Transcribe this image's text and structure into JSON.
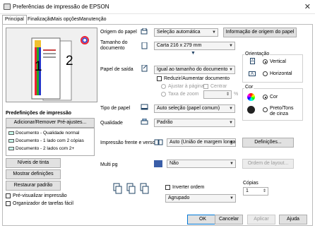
{
  "window": {
    "title": "Preferências de impressão de EPSON"
  },
  "tabs": [
    "Principal",
    "Finalização",
    "Mais opções",
    "Manutenção"
  ],
  "preview": {
    "page1": "1",
    "page2": "2"
  },
  "presets": {
    "title": "Predefinições de impressão",
    "add_button": "Adicionar/Remover Pré-ajustes...",
    "items": [
      "Documento - Qualidade normal",
      "Documento - 1 lado com 2 cópias",
      "Documento - 2 lados com 2+"
    ]
  },
  "left_buttons": {
    "ink": "Níveis de tinta",
    "show": "Mostrar definições",
    "restore": "Restaurar padrão"
  },
  "left_checks": {
    "preview": "Pré-visualizar impressão",
    "organizer": "Organizador de tarefas fácil"
  },
  "form": {
    "source_label": "Origem do papel",
    "source_value": "Seleção automática",
    "source_info_button": "Informação de origem do papel",
    "size_label_1": "Tamanho do",
    "size_label_2": "documento",
    "size_value": "Carta 216 x 279 mm",
    "output_label": "Papel de saída",
    "output_value": "Igual ao tamanho do documento",
    "reduce_label": "Reduzir/Aumentar documento",
    "fit_label": "Ajustar à página",
    "center_label": "Centrar",
    "zoom_label": "Taxa de zoom",
    "zoom_unit": "%",
    "type_label": "Tipo de papel",
    "type_value": "Auto seleção (papel comum)",
    "quality_label": "Qualidade",
    "quality_value": "Padrão",
    "duplex_label": "Impressão frente e verso",
    "duplex_value": "Auto (União de margem longa",
    "duplex_button": "Definições...",
    "multipage_label": "Multi pg",
    "multipage_value": "Não",
    "layout_button": "Ordem de layout...",
    "reverse_label": "Inverter ordem",
    "collate_value": "Agrupado",
    "copies_label": "Cópias",
    "copies_value": "1"
  },
  "orientation": {
    "title": "Orientação",
    "portrait": "Vertical",
    "landscape": "Horizontal",
    "portrait_icon": "A",
    "landscape_icon": "A"
  },
  "color": {
    "title": "Cor",
    "color": "Cor",
    "gray_1": "Preto/Tons",
    "gray_2": "de cinza"
  },
  "footer": {
    "ok": "OK",
    "cancel": "Cancelar",
    "apply": "Aplicar",
    "help": "Ajuda"
  }
}
